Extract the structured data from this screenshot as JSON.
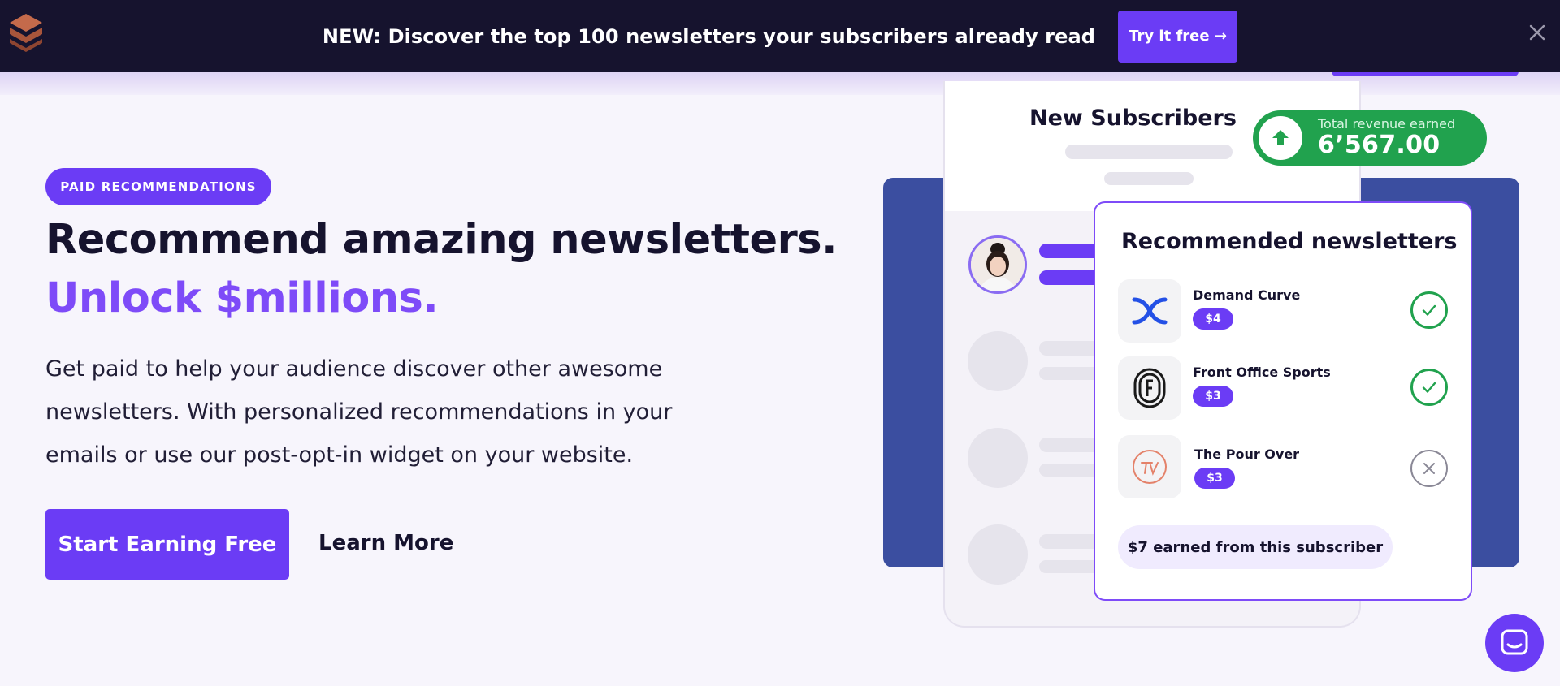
{
  "banner": {
    "text": "NEW: Discover the top 100 newsletters your subscribers already read",
    "cta_label": "Try it free →"
  },
  "hero": {
    "badge": "PAID RECOMMENDATIONS",
    "headline": "Recommend amazing newsletters.",
    "headline_accent": "Unlock $millions.",
    "description": "Get paid to help your audience discover other awesome newsletters. With personalized recommendations in your emails or use our post-opt-in widget on your website.",
    "primary_cta": "Start Earning Free",
    "secondary_cta": "Learn More"
  },
  "illustration": {
    "phone_title": "New Subscribers",
    "revenue": {
      "label": "Total revenue earned",
      "value": "6’567.00"
    },
    "rec_card": {
      "title": "Recommended newsletters",
      "items": [
        {
          "name": "Demand Curve",
          "price": "$4",
          "status": "accepted",
          "icon": "demand-curve-logo"
        },
        {
          "name": "Front Office Sports",
          "price": "$3",
          "status": "accepted",
          "icon": "front-office-sports-logo"
        },
        {
          "name": "The Pour Over",
          "price": "$3",
          "status": "declined",
          "icon": "the-pour-over-logo"
        }
      ],
      "earned": "$7 earned from this subscriber"
    }
  },
  "colors": {
    "brand_purple": "#6b3cf5",
    "accent_purple": "#7e4bf8",
    "banner_bg": "#16132e",
    "panel_blue": "#3b4ea0",
    "success_green": "#21a24e",
    "page_bg": "#f7f5fc"
  }
}
